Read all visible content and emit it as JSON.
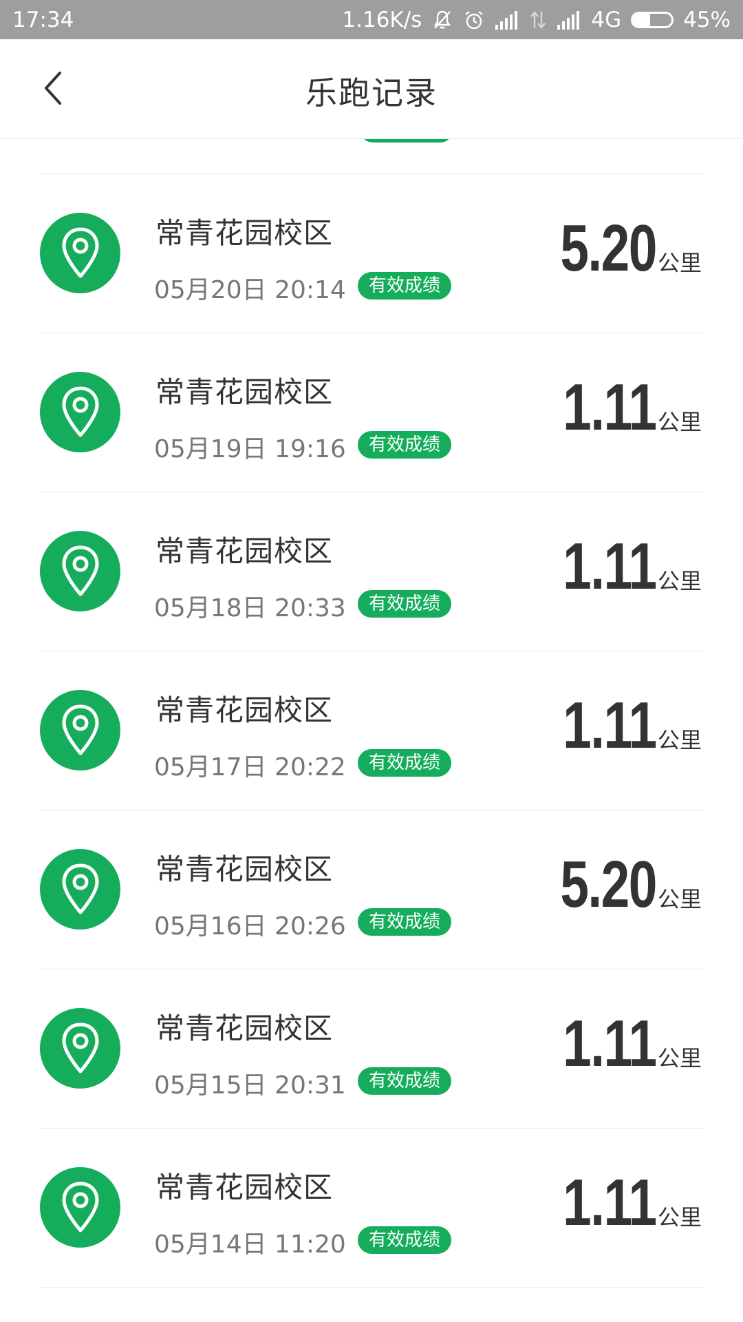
{
  "status_bar": {
    "time": "17:34",
    "net_speed": "1.16K/s",
    "network_type": "4G",
    "battery": "45%",
    "battery_level": 0.45,
    "icons": [
      "bell-off-icon",
      "alarm-icon",
      "signal-icon",
      "data-arrows-icon",
      "signal-icon",
      "battery-icon"
    ]
  },
  "header": {
    "title": "乐跑记录",
    "back_icon": "chevron-left-icon"
  },
  "colors": {
    "accent": "#15ad5c",
    "status_bar_bg": "#9e9e9e",
    "text_primary": "#333333",
    "text_secondary": "#777777",
    "divider": "#e6e6e6"
  },
  "records": [
    {
      "campus": "常青花园校区",
      "datetime": "05月20日 20:14",
      "badge": "有效成绩",
      "distance": "5.20",
      "unit": "公里",
      "icon": "location-pin-icon"
    },
    {
      "campus": "常青花园校区",
      "datetime": "05月19日 19:16",
      "badge": "有效成绩",
      "distance": "1.11",
      "unit": "公里",
      "icon": "location-pin-icon"
    },
    {
      "campus": "常青花园校区",
      "datetime": "05月18日 20:33",
      "badge": "有效成绩",
      "distance": "1.11",
      "unit": "公里",
      "icon": "location-pin-icon"
    },
    {
      "campus": "常青花园校区",
      "datetime": "05月17日 20:22",
      "badge": "有效成绩",
      "distance": "1.11",
      "unit": "公里",
      "icon": "location-pin-icon"
    },
    {
      "campus": "常青花园校区",
      "datetime": "05月16日 20:26",
      "badge": "有效成绩",
      "distance": "5.20",
      "unit": "公里",
      "icon": "location-pin-icon"
    },
    {
      "campus": "常青花园校区",
      "datetime": "05月15日 20:31",
      "badge": "有效成绩",
      "distance": "1.11",
      "unit": "公里",
      "icon": "location-pin-icon"
    },
    {
      "campus": "常青花园校区",
      "datetime": "05月14日 11:20",
      "badge": "有效成绩",
      "distance": "1.11",
      "unit": "公里",
      "icon": "location-pin-icon"
    }
  ]
}
